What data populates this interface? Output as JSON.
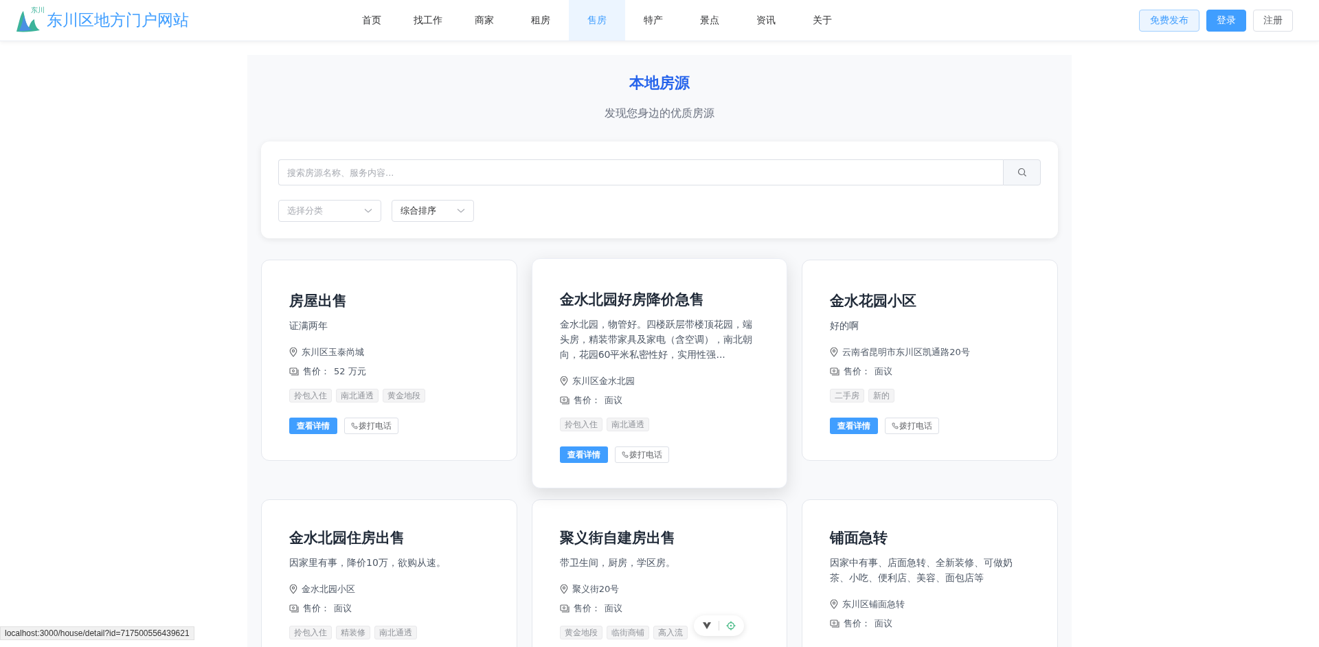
{
  "header": {
    "site_name": "东川区地方门户网站",
    "logo_text": "东川",
    "nav": [
      {
        "label": "首页",
        "selected": false
      },
      {
        "label": "找工作",
        "selected": false
      },
      {
        "label": "商家",
        "selected": false
      },
      {
        "label": "租房",
        "selected": false
      },
      {
        "label": "售房",
        "selected": true
      },
      {
        "label": "特产",
        "selected": false
      },
      {
        "label": "景点",
        "selected": false
      },
      {
        "label": "资讯",
        "selected": false
      },
      {
        "label": "关于",
        "selected": false
      }
    ],
    "actions": [
      {
        "label": "免费发布",
        "kind": "light"
      },
      {
        "label": "登录",
        "kind": "primary"
      },
      {
        "label": "注册",
        "kind": "plain"
      }
    ]
  },
  "hero": {
    "title": "本地房源",
    "subtitle": "发现您身边的优质房源"
  },
  "search": {
    "placeholder": "搜索房源名称、服务内容...",
    "filters": [
      {
        "placeholder": "选择分类"
      },
      {
        "value": "综合排序"
      }
    ]
  },
  "listings": [
    {
      "title": "房屋出售",
      "description": "证满两年",
      "location": "东川区玉泰尚城",
      "price_label": "售价：",
      "price": "52 万元",
      "tags": [
        "拎包入住",
        "南北通透",
        "黄金地段"
      ],
      "hovered": false,
      "detail_button": "查看详情",
      "call_button": "拨打电话"
    },
    {
      "title": "金水北园好房降价急售",
      "description": "金水北园，物管好。四楼跃层带楼顶花园，端头房，精装带家具及家电（含空调），南北朝向，花园60平米私密性好，实用性强...",
      "location": "东川区金水北园",
      "price_label": "售价：",
      "price": "面议",
      "tags": [
        "拎包入住",
        "南北通透"
      ],
      "hovered": true,
      "detail_button": "查看详情",
      "call_button": "拨打电话"
    },
    {
      "title": "金水花园小区",
      "description": "好的啊",
      "location": "云南省昆明市东川区凯通路20号",
      "price_label": "售价：",
      "price": "面议",
      "tags": [
        "二手房",
        "新的"
      ],
      "hovered": false,
      "detail_button": "查看详情",
      "call_button": "拨打电话"
    },
    {
      "title": "金水北园住房出售",
      "description": "因家里有事，降价10万，欲购从速。",
      "location": "金水北园小区",
      "price_label": "售价：",
      "price": "面议",
      "tags": [
        "拎包入住",
        "精装修",
        "南北通透"
      ],
      "hovered": false
    },
    {
      "title": "聚义街自建房出售",
      "description": "带卫生间，厨房，学区房。",
      "location": "聚义街20号",
      "price_label": "售价：",
      "price": "面议",
      "tags": [
        "黄金地段",
        "临街商铺",
        "高入流"
      ],
      "hovered": false
    },
    {
      "title": "铺面急转",
      "description": "因家中有事、店面急转、全新装修、可做奶茶、小吃、便利店、美容、面包店等",
      "location": "东川区铺面急转",
      "price_label": "售价：",
      "price": "面议",
      "hovered": false
    }
  ],
  "status_bar": {
    "url": "localhost:3000/house/detail?id=717500556439621"
  }
}
